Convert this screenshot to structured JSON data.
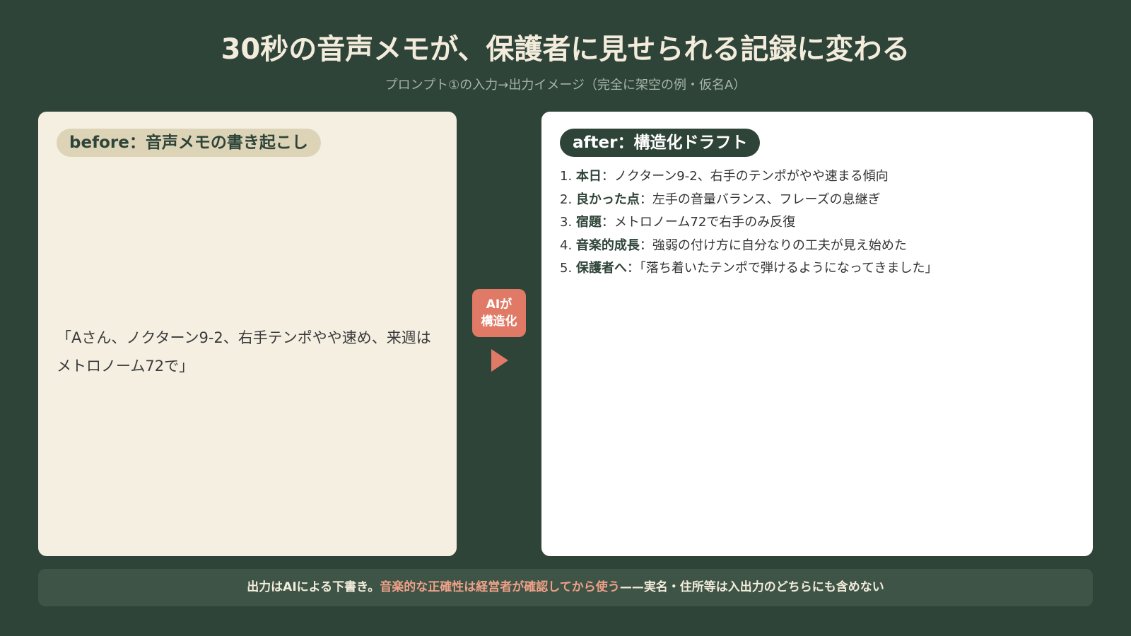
{
  "header": {
    "title": "30秒の音声メモが、保護者に見せられる記録に変わる",
    "subtitle": "プロンプト①の入力→出力イメージ（完全に架空の例・仮名A）"
  },
  "before": {
    "label": "before：音声メモの書き起こし",
    "text": "「Aさん、ノクターン9-2、右手テンポやや速め、来週はメトロノーム72で」"
  },
  "transition": {
    "line1": "AIが",
    "line2": "構造化",
    "icon": "play-arrow-icon",
    "color": "#e07a66"
  },
  "after": {
    "label": "after：構造化ドラフト",
    "items": [
      {
        "num": "1.",
        "key": "本日",
        "value": "：ノクターン9-2、右手のテンポがやや速まる傾向"
      },
      {
        "num": "2.",
        "key": "良かった点",
        "value": "：左手の音量バランス、フレーズの息継ぎ"
      },
      {
        "num": "3.",
        "key": "宿題",
        "value": "：メトロノーム72で右手のみ反復"
      },
      {
        "num": "4.",
        "key": "音楽的成長",
        "value": "：強弱の付け方に自分なりの工夫が見え始めた"
      },
      {
        "num": "5.",
        "key": "保護者へ",
        "value": "：「落ち着いたテンポで弾けるようになってきました」"
      }
    ]
  },
  "footer": {
    "part1": "出力はAIによる下書き。",
    "highlight": "音楽的な正確性は経営者が確認してから使う",
    "part2": "——実名・住所等は入出力のどちらにも含めない"
  },
  "colors": {
    "background": "#2f4438",
    "accent": "#e07a66",
    "before_panel": "#f5efe2",
    "after_panel": "#ffffff",
    "highlight": "#f0a088"
  }
}
